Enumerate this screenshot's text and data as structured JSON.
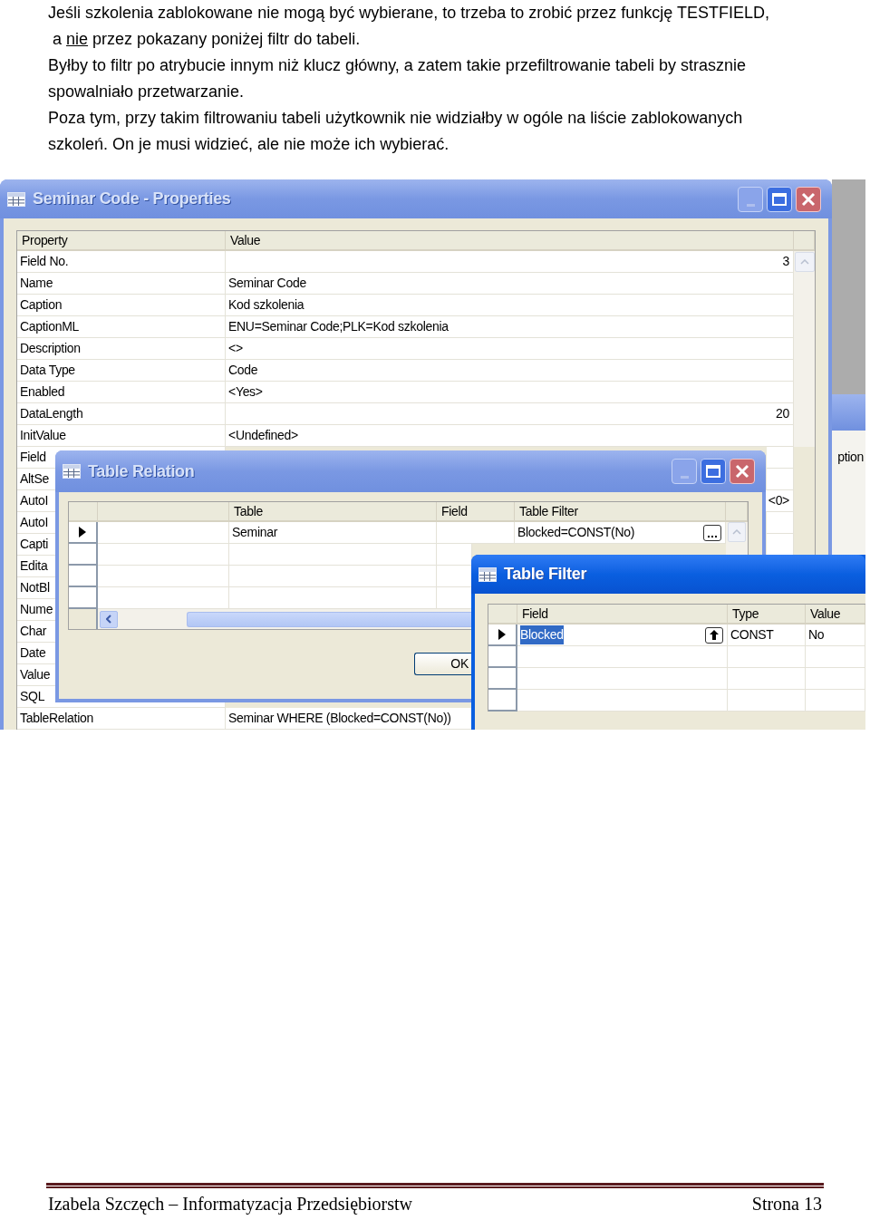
{
  "document": {
    "paragraphs": [
      {
        "segments": [
          {
            "text": "Jeśli szkolenia zablokowane nie mogą być wybierane, to trzeba to zrobić przez funkcję TESTFIELD,"
          }
        ]
      },
      {
        "segments": [
          {
            "text": " a ",
            "underline": false
          },
          {
            "text": "nie",
            "underline": true
          },
          {
            "text": " przez pokazany poniżej filtr do tabeli.",
            "underline": false
          }
        ]
      },
      {
        "segments": [
          {
            "text": "Byłby to filtr po atrybucie innym niż klucz główny, a zatem takie przefiltrowanie tabeli by strasznie spowalniało przetwarzanie."
          }
        ]
      },
      {
        "segments": [
          {
            "text": "Poza tym, przy takim filtrowaniu tabeli użytkownik nie widziałby w ogóle na liście zablokowanych szkoleń. On je musi widzieć, ale nie może ich wybierać."
          }
        ]
      }
    ]
  },
  "properties_window": {
    "title": "Seminar Code - Properties",
    "active": false,
    "columns": [
      "Property",
      "Value"
    ],
    "rows": [
      {
        "property": "Field No.",
        "value": "3",
        "kind": "number"
      },
      {
        "property": "Name",
        "value": "Seminar Code",
        "kind": "text"
      },
      {
        "property": "Caption",
        "value": "Kod szkolenia",
        "kind": "text"
      },
      {
        "property": "CaptionML",
        "value": "ENU=Seminar Code;PLK=Kod szkolenia",
        "kind": "text"
      },
      {
        "property": "Description",
        "value": "<>",
        "kind": "text"
      },
      {
        "property": "Data Type",
        "value": "Code",
        "kind": "text"
      },
      {
        "property": "Enabled",
        "value": "<Yes>",
        "kind": "text"
      },
      {
        "property": "DataLength",
        "value": "20",
        "kind": "number"
      },
      {
        "property": "InitValue",
        "value": "<Undefined>",
        "kind": "text"
      },
      {
        "property": "Field"
      },
      {
        "property": "AltSe"
      },
      {
        "property": "AutoI",
        "value": "<0>",
        "kind": "number"
      },
      {
        "property": "AutoI"
      },
      {
        "property": "Capti"
      },
      {
        "property": "Edita"
      },
      {
        "property": "NotBl"
      },
      {
        "property": "Nume"
      },
      {
        "property": "Char"
      },
      {
        "property": "Date"
      },
      {
        "property": "Value"
      },
      {
        "property": "SQL"
      },
      {
        "property": "TableRelation",
        "value": "Seminar WHERE (Blocked=CONST(No))",
        "kind": "text"
      }
    ]
  },
  "background_window": {
    "text": "ption"
  },
  "table_relation_window": {
    "title": "Table Relation",
    "active": false,
    "columns": [
      "Table",
      "Field",
      "Table Filter"
    ],
    "rows": [
      {
        "table": "Seminar",
        "table_filter": "Blocked=CONST(No)",
        "selected": true
      }
    ],
    "ok_button": "OK"
  },
  "table_filter_window": {
    "title": "Table Filter",
    "active": true,
    "columns": [
      "Field",
      "Type",
      "Value"
    ],
    "rows": [
      {
        "field": "Blocked",
        "type": "CONST",
        "value": "No",
        "selected": true,
        "highlighted": true
      }
    ]
  },
  "footer": {
    "left": "Izabela Szczęch – Informatyzacja Przedsiębiorstw",
    "right": "Strona 13"
  }
}
